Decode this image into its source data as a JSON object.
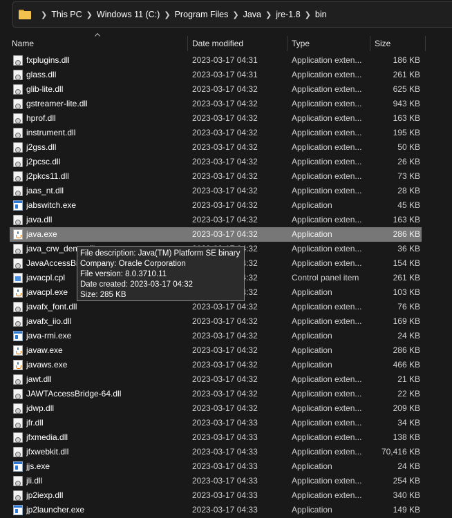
{
  "breadcrumb": [
    "This PC",
    "Windows 11 (C:)",
    "Program Files",
    "Java",
    "jre-1.8",
    "bin"
  ],
  "columns": {
    "name": "Name",
    "date": "Date modified",
    "type": "Type",
    "size": "Size"
  },
  "files": [
    {
      "name": "fxplugins.dll",
      "date": "2023-03-17 04:31",
      "type": "Application exten...",
      "size": "186 KB",
      "icon": "dll-file-icon"
    },
    {
      "name": "glass.dll",
      "date": "2023-03-17 04:31",
      "type": "Application exten...",
      "size": "261 KB",
      "icon": "dll-file-icon"
    },
    {
      "name": "glib-lite.dll",
      "date": "2023-03-17 04:32",
      "type": "Application exten...",
      "size": "625 KB",
      "icon": "dll-file-icon"
    },
    {
      "name": "gstreamer-lite.dll",
      "date": "2023-03-17 04:32",
      "type": "Application exten...",
      "size": "943 KB",
      "icon": "dll-file-icon"
    },
    {
      "name": "hprof.dll",
      "date": "2023-03-17 04:32",
      "type": "Application exten...",
      "size": "163 KB",
      "icon": "dll-file-icon"
    },
    {
      "name": "instrument.dll",
      "date": "2023-03-17 04:32",
      "type": "Application exten...",
      "size": "195 KB",
      "icon": "dll-file-icon"
    },
    {
      "name": "j2gss.dll",
      "date": "2023-03-17 04:32",
      "type": "Application exten...",
      "size": "50 KB",
      "icon": "dll-file-icon"
    },
    {
      "name": "j2pcsc.dll",
      "date": "2023-03-17 04:32",
      "type": "Application exten...",
      "size": "26 KB",
      "icon": "dll-file-icon"
    },
    {
      "name": "j2pkcs11.dll",
      "date": "2023-03-17 04:32",
      "type": "Application exten...",
      "size": "73 KB",
      "icon": "dll-file-icon"
    },
    {
      "name": "jaas_nt.dll",
      "date": "2023-03-17 04:32",
      "type": "Application exten...",
      "size": "28 KB",
      "icon": "dll-file-icon"
    },
    {
      "name": "jabswitch.exe",
      "date": "2023-03-17 04:32",
      "type": "Application",
      "size": "45 KB",
      "icon": "exe-file-icon"
    },
    {
      "name": "java.dll",
      "date": "2023-03-17 04:32",
      "type": "Application exten...",
      "size": "163 KB",
      "icon": "dll-file-icon"
    },
    {
      "name": "java.exe",
      "date": "2023-03-17 04:32",
      "type": "Application",
      "size": "286 KB",
      "icon": "java-file-icon",
      "selected": true
    },
    {
      "name": "java_crw_demo.dll",
      "date": "2023-03-17 04:32",
      "type": "Application exten...",
      "size": "36 KB",
      "icon": "dll-file-icon"
    },
    {
      "name": "JavaAccessBridge-64.dll",
      "date": "2023-03-17 04:32",
      "type": "Application exten...",
      "size": "154 KB",
      "icon": "dll-file-icon"
    },
    {
      "name": "javacpl.cpl",
      "date": "2023-03-17 04:32",
      "type": "Control panel item",
      "size": "261 KB",
      "icon": "cpl-file-icon"
    },
    {
      "name": "javacpl.exe",
      "date": "2023-03-17 04:32",
      "type": "Application",
      "size": "103 KB",
      "icon": "java-file-icon"
    },
    {
      "name": "javafx_font.dll",
      "date": "2023-03-17 04:32",
      "type": "Application exten...",
      "size": "76 KB",
      "icon": "dll-file-icon"
    },
    {
      "name": "javafx_iio.dll",
      "date": "2023-03-17 04:32",
      "type": "Application exten...",
      "size": "169 KB",
      "icon": "dll-file-icon"
    },
    {
      "name": "java-rmi.exe",
      "date": "2023-03-17 04:32",
      "type": "Application",
      "size": "24 KB",
      "icon": "exe-file-icon"
    },
    {
      "name": "javaw.exe",
      "date": "2023-03-17 04:32",
      "type": "Application",
      "size": "286 KB",
      "icon": "java-file-icon"
    },
    {
      "name": "javaws.exe",
      "date": "2023-03-17 04:32",
      "type": "Application",
      "size": "466 KB",
      "icon": "java-file-icon"
    },
    {
      "name": "jawt.dll",
      "date": "2023-03-17 04:32",
      "type": "Application exten...",
      "size": "21 KB",
      "icon": "dll-file-icon"
    },
    {
      "name": "JAWTAccessBridge-64.dll",
      "date": "2023-03-17 04:32",
      "type": "Application exten...",
      "size": "22 KB",
      "icon": "dll-file-icon"
    },
    {
      "name": "jdwp.dll",
      "date": "2023-03-17 04:32",
      "type": "Application exten...",
      "size": "209 KB",
      "icon": "dll-file-icon"
    },
    {
      "name": "jfr.dll",
      "date": "2023-03-17 04:33",
      "type": "Application exten...",
      "size": "34 KB",
      "icon": "dll-file-icon"
    },
    {
      "name": "jfxmedia.dll",
      "date": "2023-03-17 04:33",
      "type": "Application exten...",
      "size": "138 KB",
      "icon": "dll-file-icon"
    },
    {
      "name": "jfxwebkit.dll",
      "date": "2023-03-17 04:33",
      "type": "Application exten...",
      "size": "70,416 KB",
      "icon": "dll-file-icon"
    },
    {
      "name": "jjs.exe",
      "date": "2023-03-17 04:33",
      "type": "Application",
      "size": "24 KB",
      "icon": "exe-file-icon"
    },
    {
      "name": "jli.dll",
      "date": "2023-03-17 04:33",
      "type": "Application exten...",
      "size": "254 KB",
      "icon": "dll-file-icon"
    },
    {
      "name": "jp2iexp.dll",
      "date": "2023-03-17 04:33",
      "type": "Application exten...",
      "size": "340 KB",
      "icon": "dll-file-icon"
    },
    {
      "name": "jp2launcher.exe",
      "date": "2023-03-17 04:33",
      "type": "Application",
      "size": "149 KB",
      "icon": "exe-file-icon"
    }
  ],
  "tooltip": {
    "description": "File description: Java(TM) Platform SE binary",
    "company": "Company: Oracle Corporation",
    "version": "File version: 8.0.3710.11",
    "created": "Date created: 2023-03-17 04:32",
    "size": "Size: 285 KB"
  },
  "colors": {
    "background": "#191919",
    "selected_row": "#777777",
    "folder": "#f2c14e"
  }
}
